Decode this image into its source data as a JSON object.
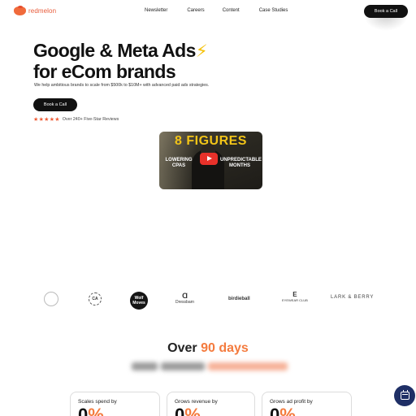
{
  "brand": {
    "name": "redmelon",
    "color": "#e85b3a"
  },
  "nav": {
    "links": [
      "Newsletter",
      "Careers",
      "Content",
      "Case Studies"
    ],
    "cta_label": "Book a Call"
  },
  "hero": {
    "title_line1": "Google & Meta Ads",
    "title_emoji": "⚡",
    "title_line2": "for eCom brands",
    "subtitle": "We help ambitious brands to scale from $500k to $10M+ with advanced paid ads strategies.",
    "cta_label": "Book a Call",
    "rating_stars": "★★★★★",
    "rating_text": "Over 240+ Five-Star Reviews"
  },
  "video": {
    "headline": "8 FIGURES",
    "left_caption": "LOWERING CPAS",
    "right_caption": "UNPREDICTABLE MONTHS",
    "play_icon": "play-icon"
  },
  "client_logos": {
    "logo1": "",
    "logo2": "CA",
    "logo3": "Wolf Moves",
    "logo4": "Dressbarn",
    "logo4_mark": "Ɑ",
    "logo5": "birdieball",
    "logo6_mark": "E",
    "logo6": "EYEWEAR CLUB",
    "logo7": "LARK & BERRY",
    "logo7_sub": ""
  },
  "stats": {
    "title_prefix": "Over",
    "title_accent": "90 days",
    "accent_color": "#f47b3e",
    "cards": [
      {
        "label": "Scales spend by",
        "value": "0",
        "unit": "%"
      },
      {
        "label": "Grows revenue by",
        "value": "0",
        "unit": "%"
      },
      {
        "label": "Grows ad profit by",
        "value": "0",
        "unit": "%"
      }
    ]
  },
  "floating_button": {
    "icon": "calendar-icon",
    "color": "#1f2f66"
  }
}
